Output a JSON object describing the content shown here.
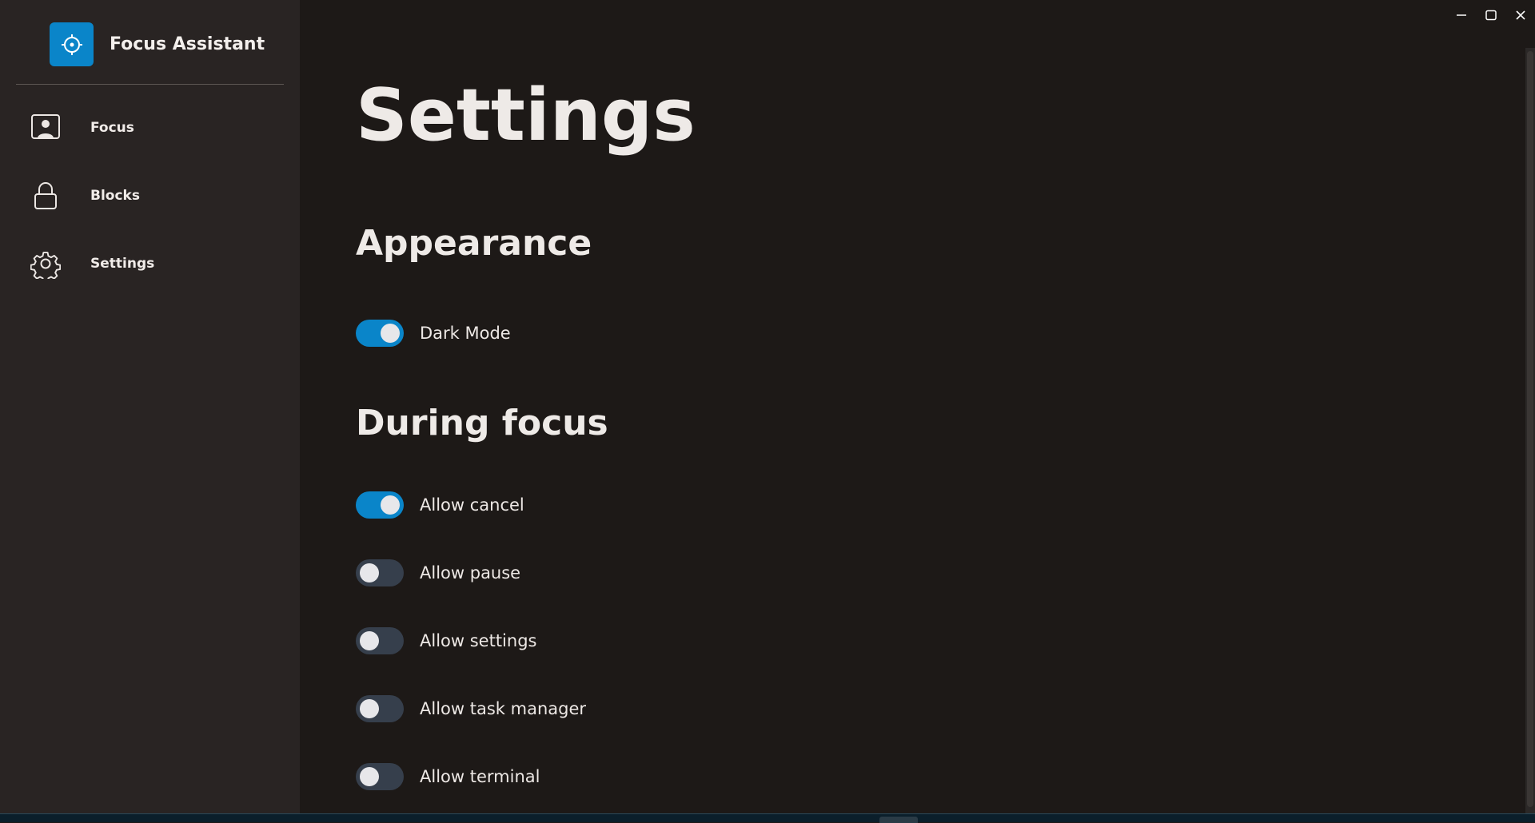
{
  "app": {
    "title": "Focus Assistant",
    "accent_color": "#0a85c9"
  },
  "sidebar": {
    "items": [
      {
        "label": "Focus",
        "icon": "person-screen-icon"
      },
      {
        "label": "Blocks",
        "icon": "lock-icon"
      },
      {
        "label": "Settings",
        "icon": "gear-icon"
      }
    ]
  },
  "main": {
    "title": "Settings",
    "sections": [
      {
        "title": "Appearance",
        "settings": [
          {
            "label": "Dark Mode",
            "enabled": true
          }
        ]
      },
      {
        "title": "During focus",
        "settings": [
          {
            "label": "Allow cancel",
            "enabled": true
          },
          {
            "label": "Allow pause",
            "enabled": false
          },
          {
            "label": "Allow settings",
            "enabled": false
          },
          {
            "label": "Allow task manager",
            "enabled": false
          },
          {
            "label": "Allow terminal",
            "enabled": false
          }
        ]
      }
    ]
  },
  "window_controls": {
    "icons": [
      "minimize-icon",
      "maximize-icon",
      "close-icon"
    ]
  }
}
